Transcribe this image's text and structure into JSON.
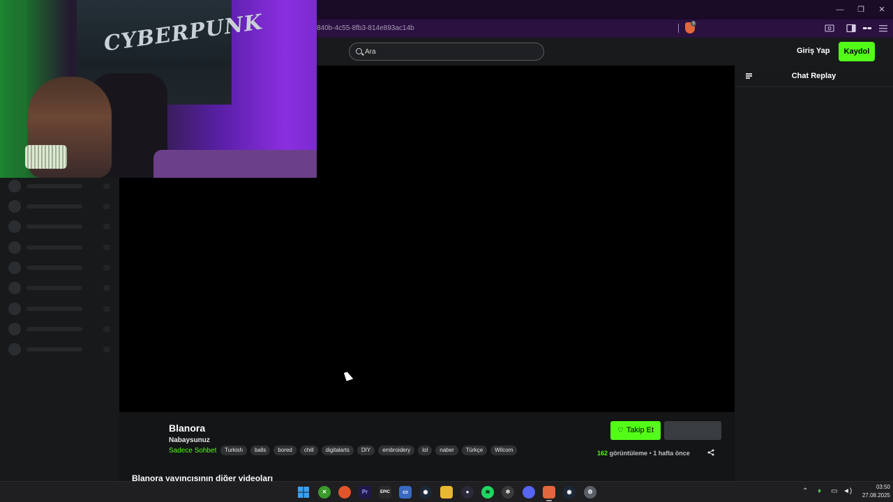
{
  "browser": {
    "url": "840b-4c55-8fb3-814e893ac14b",
    "extension_badge": "5"
  },
  "header": {
    "search_placeholder": "Ara",
    "login_label": "Giriş Yap",
    "signup_label": "Kaydol"
  },
  "webcam": {
    "poster_text": "CYBERPUNK"
  },
  "chat": {
    "title": "Chat Replay"
  },
  "stream": {
    "channel_name": "Blanora",
    "title": "Nabaysunuz",
    "category": "Sadece Sohbet",
    "tags": [
      "Turkish",
      "balls",
      "bored",
      "chill",
      "digitalarts",
      "DIY",
      "embroidery",
      "lol",
      "naber",
      "Türkçe",
      "Wilcom"
    ],
    "follow_label": "Takip Et",
    "views_count": "162",
    "views_label": "görüntüleme",
    "separator": "•",
    "time_ago": "1 hafta önce",
    "other_videos_heading": "Blanora yayıncısının diğer videoları"
  },
  "taskbar": {
    "time": "03:50",
    "date": "27.08.2025",
    "apps": [
      "windows-start",
      "xbox",
      "origin",
      "premiere-pro",
      "epic-games",
      "remote-desktop",
      "steam",
      "file-explorer",
      "obs",
      "spotify",
      "chatgpt",
      "discord",
      "brave",
      "steam-2",
      "settings"
    ]
  },
  "colors": {
    "accent": "#53fc18",
    "background": "#141517",
    "titlebar": "#1a0b26",
    "addressbar": "#2a1140"
  }
}
